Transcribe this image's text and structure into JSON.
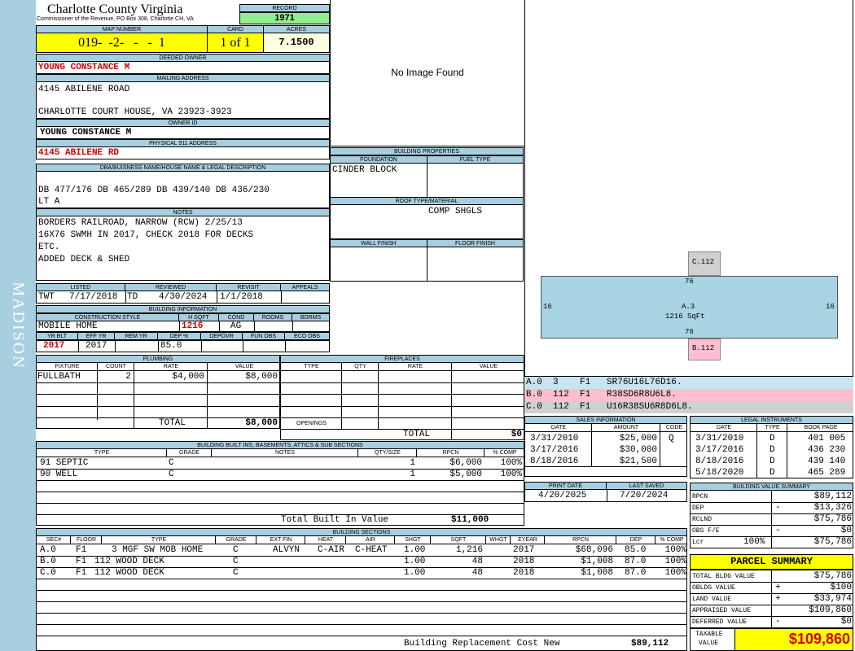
{
  "sidebar": {
    "district": "MADISON"
  },
  "header": {
    "county": "Charlotte County Virginia",
    "commissioner": "Commissioner of the Revenue, PO Box 308, Charlotte CH, VA",
    "record_label": "RECORD",
    "record_value": "1971",
    "map_label": "MAP NUMBER",
    "map_value": "019-  -2-   -   -  1",
    "card_label": "CARD",
    "card_value": "1 of 1",
    "acres_label": "ACRES",
    "acres_value": "7.1500"
  },
  "owner": {
    "deeded_label": "DEEDED OWNER",
    "deeded_value": "YOUNG CONSTANCE M",
    "mailing_label": "MAILING ADDRESS",
    "mailing_line1": "4145 ABILENE ROAD",
    "mailing_line2": "CHARLOTTE COURT HOUSE, VA 23923-3923",
    "owner_id_label": "OWNER ID",
    "owner_id_value": "YOUNG CONSTANCE M",
    "physical_label": "PHYSICAL 911 ADDRESS",
    "physical_value": "4145 ABILENE RD",
    "legal_label": "DBA/BUISNESS NAME/HOUSE NAME & LEGAL DESCRIPTION",
    "legal_line1": "DB 477/176 DB 465/289 DB 439/140 DB 436/230",
    "legal_line2": "LT A",
    "notes_label": "NOTES",
    "notes_lines": [
      "BORDERS RAILROAD, NARROW (RCW) 2/25/13",
      "16X76 SWMH IN 2017, CHECK 2018 FOR DECKS",
      "ETC.",
      "ADDED DECK & SHED"
    ]
  },
  "image": {
    "placeholder": "No Image Found"
  },
  "listing": {
    "listed_label": "LISTED",
    "listed_by": "TWT",
    "listed_date": "7/17/2018",
    "reviewed_label": "REVIEWED",
    "reviewed_by": "TD",
    "reviewed_date": "4/30/2024",
    "revisit_label": "REVISIT",
    "revisit_date": "1/1/2018",
    "appeals_label": "APPEALS"
  },
  "building_info": {
    "title": "BUILDING INFORMATION",
    "style_label": "CONSTRUCTION STYLE",
    "style_value": "MOBILE HOME",
    "hsqft_label": "H SQFT",
    "hsqft_value": "1216",
    "cond_label": "COND",
    "cond_value": "AG",
    "rooms_label": "ROOMS",
    "bdrms_label": "BDRMS",
    "yrblt_label": "YR BLT",
    "yrblt_value": "2017",
    "effyr_label": "EFF YR",
    "effyr_value": "2017",
    "remyr_label": "REM YR",
    "dep_label": "DEP %",
    "dep_value": "85.0",
    "depovr_label": "DEPOVR",
    "funobs_label": "FUN OBS",
    "ecoobs_label": "ECO OBS"
  },
  "properties": {
    "title": "BUILDING PROPERTIES",
    "foundation_label": "FOUNDATION",
    "foundation_value": "CINDER BLOCK",
    "fuel_label": "FUEL TYPE",
    "roof_label": "ROOF TYPE/MATERIAL",
    "roof_value": "COMP SHGLS",
    "wall_label": "WALL FINISH",
    "floor_label": "FLOOR FINISH"
  },
  "sketch": {
    "top_label": "C.112",
    "bottom_label": "B.112",
    "main_label": "A.3",
    "main_sqft": "1216 SqFt",
    "dim_top": "76",
    "dim_bottom": "76",
    "dim_left": "16",
    "dim_right": "16",
    "legend": [
      {
        "text": "A.0  3    F1   SR76U16L76D16.",
        "color": "#c8e4ef"
      },
      {
        "text": "B.0  112  F1   R38SD6R8U6L8.",
        "color": "#ffbfd0"
      },
      {
        "text": "C.0  112  F1   U16R38SU6R8D6L8.",
        "color": "#d0d0d0"
      }
    ]
  },
  "plumbing": {
    "title": "PLUMBING",
    "headers": [
      "FIXTURE",
      "COUNT",
      "RATE",
      "VALUE"
    ],
    "rows": [
      {
        "fixture": "FULLBATH",
        "count": "2",
        "rate": "$4,000",
        "value": "$8,000"
      }
    ],
    "total_label": "TOTAL",
    "total_value": "$8,000"
  },
  "fireplaces": {
    "title": "FIREPLACES",
    "headers": [
      "TYPE",
      "QTY",
      "RATE",
      "VALUE"
    ],
    "openings_label": "OPENINGS",
    "total_label": "TOTAL",
    "total_value": "$0"
  },
  "sales": {
    "title": "SALES INFORMATION",
    "headers": [
      "DATE",
      "AMOUNT",
      "CODE"
    ],
    "rows": [
      {
        "date": "3/31/2010",
        "amount": "$25,000",
        "code": "Q"
      },
      {
        "date": "3/17/2016",
        "amount": "$30,000",
        "code": ""
      },
      {
        "date": "8/18/2016",
        "amount": "$21,500",
        "code": ""
      }
    ]
  },
  "legal_instruments": {
    "title": "LEGAL INSTRUMENTS",
    "headers": [
      "DATE",
      "TYPE",
      "BOOK PAGE"
    ],
    "rows": [
      {
        "date": "3/31/2010",
        "type": "D",
        "book": "401 005"
      },
      {
        "date": "3/17/2016",
        "type": "D",
        "book": "436 230"
      },
      {
        "date": "8/18/2016",
        "type": "D",
        "book": "439 140"
      },
      {
        "date": "5/18/2020",
        "type": "D",
        "book": "465 289"
      }
    ]
  },
  "print": {
    "print_label": "PRINT DATE",
    "print_value": "4/20/2025",
    "saved_label": "LAST SAVED",
    "saved_value": "7/20/2024"
  },
  "builtins": {
    "title": "BUILDING BUILT INS, BASEMENTS, ATTICS & SUB SECTIONS",
    "headers": [
      "TYPE",
      "GRADE",
      "NOTES",
      "QTY/SIZE",
      "RPCN",
      "% COMP"
    ],
    "rows": [
      {
        "type": "91 SEPTIC",
        "grade": "C",
        "notes": "",
        "qty": "1",
        "rpcn": "$6,000",
        "comp": "100%"
      },
      {
        "type": "90 WELL",
        "grade": "C",
        "notes": "",
        "qty": "1",
        "rpcn": "$5,000",
        "comp": "100%"
      }
    ],
    "total_label": "Total Built In Value",
    "total_value": "$11,000"
  },
  "sections": {
    "title": "BUILDING SECTIONS",
    "headers": [
      "SEC#",
      "FLOOR",
      "TYPE",
      "GRADE",
      "EXT FIN",
      "HEAT",
      "AIR",
      "SHGT",
      "SQFT",
      "WHGT",
      "EYEAR",
      "RPCN",
      "DEP",
      "% COMP"
    ],
    "rows": [
      {
        "sec": "A.0",
        "floor": "F1",
        "type": "3 MGF SW MOB HOME",
        "grade": "C",
        "ext": "ALVYN",
        "heat": "C-AIR",
        "air": "C-HEAT",
        "shgt": "1.00",
        "sqft": "1,216",
        "whgt": "",
        "eyear": "2017",
        "rpcn": "$68,096",
        "dep": "85.0",
        "comp": "100%"
      },
      {
        "sec": "B.0",
        "floor": "F1",
        "type": "112 WOOD DECK",
        "grade": "C",
        "ext": "",
        "heat": "",
        "air": "",
        "shgt": "1.00",
        "sqft": "48",
        "whgt": "",
        "eyear": "2018",
        "rpcn": "$1,008",
        "dep": "87.0",
        "comp": "100%"
      },
      {
        "sec": "C.0",
        "floor": "F1",
        "type": "112 WOOD DECK",
        "grade": "C",
        "ext": "",
        "heat": "",
        "air": "",
        "shgt": "1.00",
        "sqft": "48",
        "whgt": "",
        "eyear": "2018",
        "rpcn": "$1,008",
        "dep": "87.0",
        "comp": "100%"
      }
    ],
    "total_label": "Building Replacement Cost New",
    "total_value": "$89,112"
  },
  "value_summary": {
    "title": "BUILDING VALUE SUMMARY",
    "rows": [
      {
        "label": "RPCN",
        "sign": "",
        "pct": "",
        "value": "$89,112"
      },
      {
        "label": "DEP",
        "sign": "-",
        "pct": "",
        "value": "$13,326"
      },
      {
        "label": "RCLND",
        "sign": "",
        "pct": "",
        "value": "$75,786"
      },
      {
        "label": "OBS F/E",
        "sign": "-",
        "pct": "",
        "value": "$0"
      },
      {
        "label": "Lcr",
        "sign": "",
        "pct": "100%",
        "value": "$75,786"
      }
    ]
  },
  "parcel": {
    "title": "PARCEL SUMMARY",
    "rows": [
      {
        "label": "TOTAL BLDG VALUE",
        "sign": "",
        "value": "$75,786"
      },
      {
        "label": "OBLDG VALUE",
        "sign": "+",
        "value": "$100"
      },
      {
        "label": "LAND VALUE",
        "sign": "+",
        "value": "$33,974"
      },
      {
        "label": "APPRAISED VALUE",
        "sign": "",
        "value": "$109,860"
      },
      {
        "label": "DEFERRED VALUE",
        "sign": "-",
        "value": "$0"
      }
    ],
    "taxable_label1": "TAXABLE",
    "taxable_label2": "VALUE",
    "taxable_value": "$109,860"
  }
}
